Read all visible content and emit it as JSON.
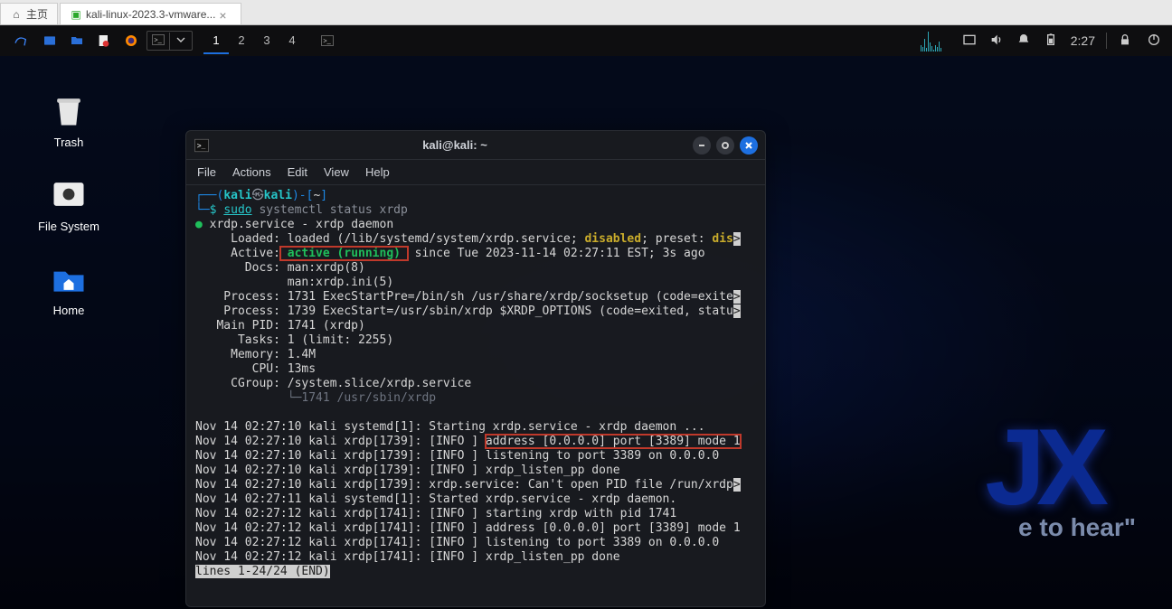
{
  "host": {
    "tab_home": "主页",
    "tab_vm": "kali-linux-2023.3-vmware..."
  },
  "panel": {
    "workspaces": [
      "1",
      "2",
      "3",
      "4"
    ],
    "active_ws": 0,
    "clock": "2:27"
  },
  "desktop_icons": [
    {
      "name": "trash",
      "label": "Trash"
    },
    {
      "name": "filesystem",
      "label": "File System"
    },
    {
      "name": "home",
      "label": "Home"
    }
  ],
  "terminal": {
    "title": "kali@kali: ~",
    "menus": [
      "File",
      "Actions",
      "Edit",
      "View",
      "Help"
    ],
    "prompt": {
      "user": "kali",
      "host": "kali",
      "path": "~",
      "sudo": "sudo",
      "cmd": "systemctl status xrdp"
    },
    "status": {
      "service_line": "xrdp.service - xrdp daemon",
      "loaded_pre": "     Loaded: loaded (/lib/systemd/system/xrdp.service; ",
      "loaded_disabled": "disabled",
      "loaded_mid": "; preset: ",
      "loaded_dis2": "dis",
      "active_label": "     Active:",
      "active_val": " active (running) ",
      "active_since": "since Tue 2023-11-14 02:27:11 EST; 3s ago",
      "docs1": "       Docs: man:xrdp(8)",
      "docs2": "             man:xrdp.ini(5)",
      "proc1": "    Process: 1731 ExecStartPre=/bin/sh /usr/share/xrdp/socksetup (code=exite",
      "proc2": "    Process: 1739 ExecStart=/usr/sbin/xrdp $XRDP_OPTIONS (code=exited, statu",
      "mainpid": "   Main PID: 1741 (xrdp)",
      "tasks": "      Tasks: 1 (limit: 2255)",
      "memory": "     Memory: 1.4M",
      "cpu": "        CPU: 13ms",
      "cgroup": "     CGroup: /system.slice/xrdp.service",
      "cgroup2": "             └─1741 /usr/sbin/xrdp"
    },
    "logs": [
      "Nov 14 02:27:10 kali systemd[1]: Starting xrdp.service - xrdp daemon ...",
      "Nov 14 02:27:10 kali xrdp[1739]: [INFO ] address [0.0.0.0] port [3389] mode 1",
      "Nov 14 02:27:10 kali xrdp[1739]: [INFO ] listening to port 3389 on 0.0.0.0",
      "Nov 14 02:27:10 kali xrdp[1739]: [INFO ] xrdp_listen_pp done",
      "Nov 14 02:27:10 kali xrdp[1739]: xrdp.service: Can't open PID file /run/xrdp",
      "Nov 14 02:27:11 kali systemd[1]: Started xrdp.service - xrdp daemon.",
      "Nov 14 02:27:12 kali xrdp[1741]: [INFO ] starting xrdp with pid 1741",
      "Nov 14 02:27:12 kali xrdp[1741]: [INFO ] address [0.0.0.0] port [3389] mode 1",
      "Nov 14 02:27:12 kali xrdp[1741]: [INFO ] listening to port 3389 on 0.0.0.0",
      "Nov 14 02:27:12 kali xrdp[1741]: [INFO ] xrdp_listen_pp done"
    ],
    "log_hl_pre": "Nov 14 02:27:10 kali xrdp[1739]: [INFO ] ",
    "log_hl": "address [0.0.0.0] port [3389] mode 1",
    "pager": "lines 1-24/24 (END)"
  },
  "wallpaper": {
    "letters": "JX",
    "text": "e to hear\""
  }
}
